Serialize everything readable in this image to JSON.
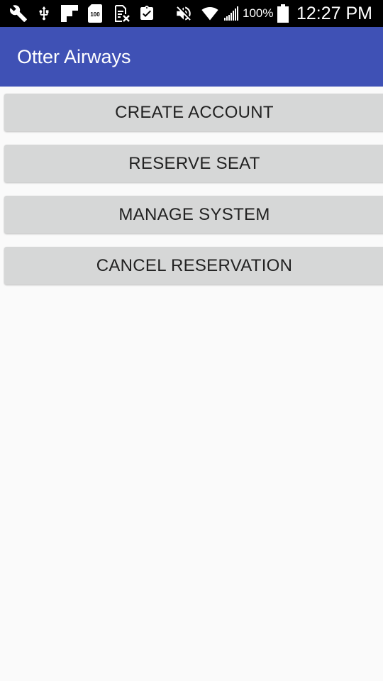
{
  "status_bar": {
    "icons": [
      "wrench-icon",
      "usb-icon",
      "flipboard-icon",
      "sd-card-100-icon",
      "no-sim-icon",
      "clipboard-check-icon",
      "mute-icon",
      "wifi-icon",
      "signal-icon",
      "battery-icon"
    ],
    "sd_badge_text": "100",
    "battery_percent": "100%",
    "time": "12:27 PM"
  },
  "app_bar": {
    "title": "Otter Airways",
    "color": "#3f51b5"
  },
  "buttons": [
    {
      "label": "CREATE ACCOUNT"
    },
    {
      "label": "RESERVE SEAT"
    },
    {
      "label": "MANAGE SYSTEM"
    },
    {
      "label": "CANCEL RESERVATION"
    }
  ],
  "colors": {
    "status_bar_bg": "#000000",
    "button_bg": "#d6d7d7",
    "background": "#fafafa"
  }
}
